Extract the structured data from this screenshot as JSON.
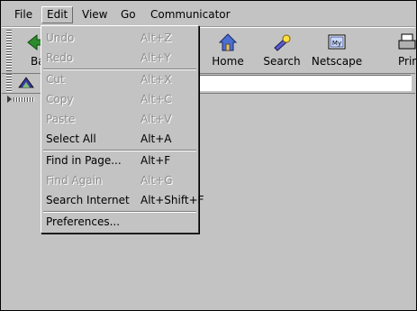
{
  "menubar": {
    "items": [
      {
        "label": "File"
      },
      {
        "label": "Edit"
      },
      {
        "label": "View"
      },
      {
        "label": "Go"
      },
      {
        "label": "Communicator"
      }
    ]
  },
  "toolbar": {
    "back_label_partial": "Ba",
    "home_label": "Home",
    "search_label": "Search",
    "netscape_label": "Netscape",
    "print_label_partial": "Prin"
  },
  "edit_menu": {
    "undo": {
      "label": "Undo",
      "accel": "Alt+Z"
    },
    "redo": {
      "label": "Redo",
      "accel": "Alt+Y"
    },
    "cut": {
      "label": "Cut",
      "accel": "Alt+X"
    },
    "copy": {
      "label": "Copy",
      "accel": "Alt+C"
    },
    "paste": {
      "label": "Paste",
      "accel": "Alt+V"
    },
    "select_all": {
      "label": "Select All",
      "accel": "Alt+A"
    },
    "find_in_page": {
      "label": "Find in Page...",
      "accel": "Alt+F"
    },
    "find_again": {
      "label": "Find Again",
      "accel": "Alt+G"
    },
    "search_internet": {
      "label": "Search Internet",
      "accel": "Alt+Shift+F"
    },
    "preferences": {
      "label": "Preferences..."
    }
  },
  "colors": {
    "background": "#c3c3c3",
    "disabled_text": "#8e8e8e"
  }
}
